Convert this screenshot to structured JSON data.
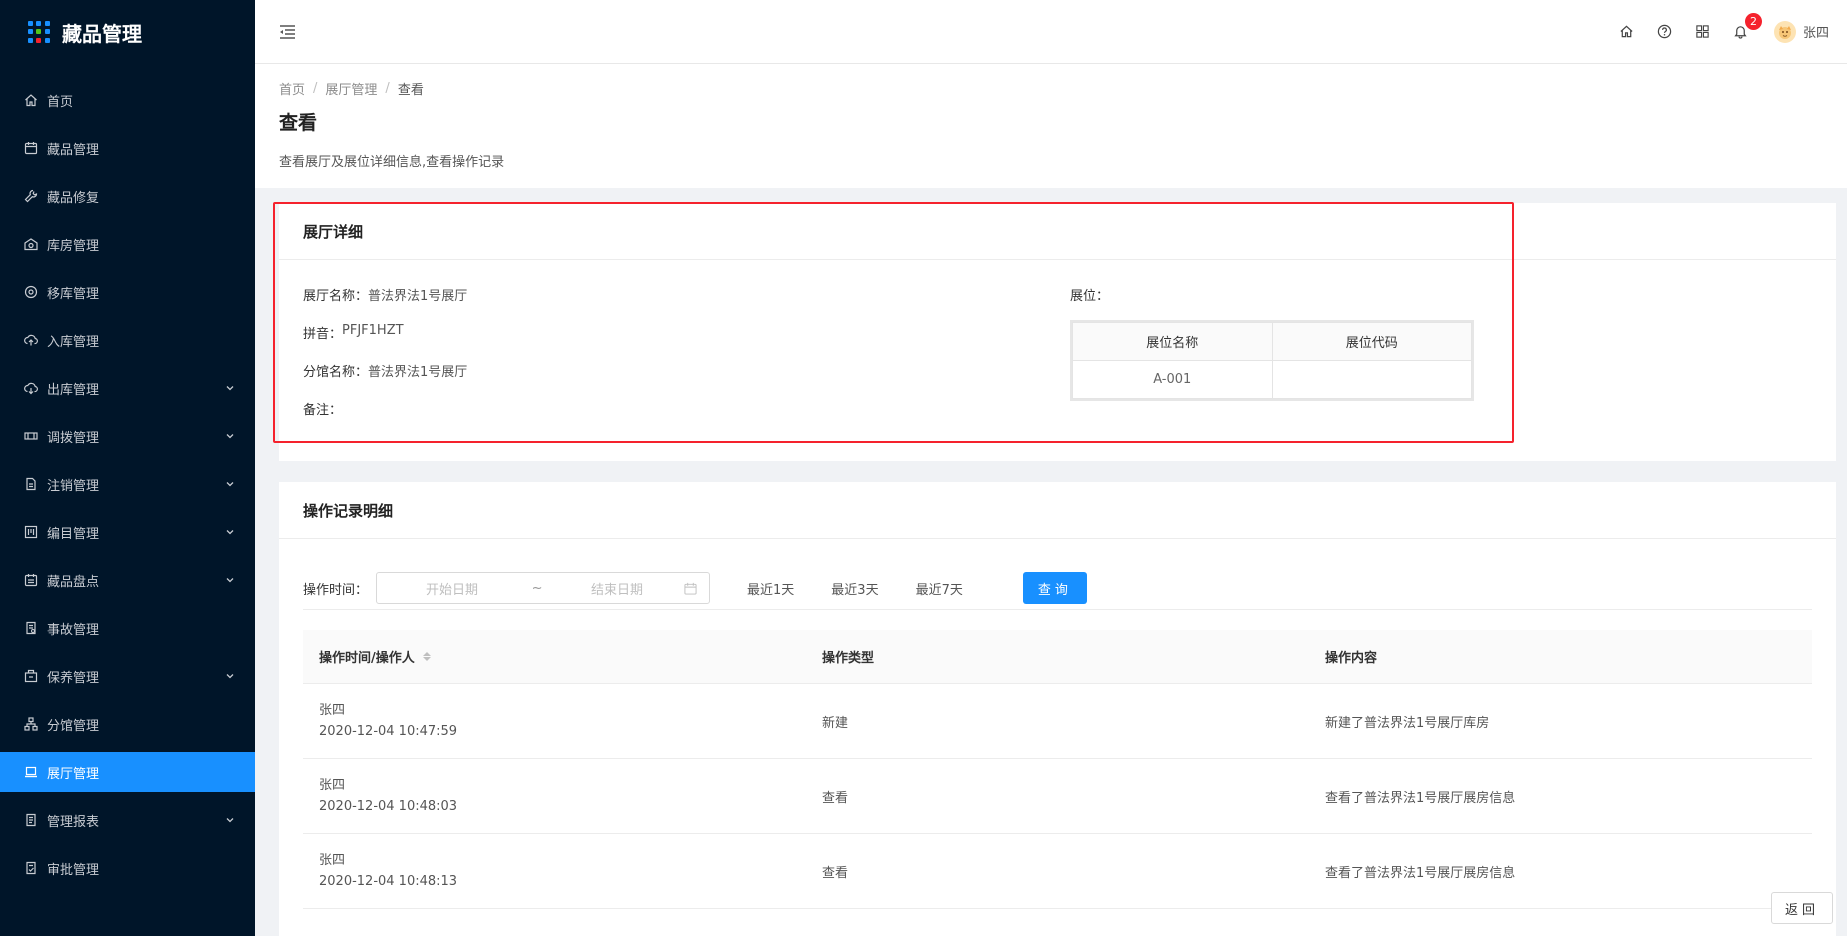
{
  "brand": {
    "title": "藏品管理"
  },
  "sidebar": {
    "items": [
      {
        "label": "首页",
        "icon": "home-icon",
        "has_arrow": false,
        "active": false
      },
      {
        "label": "藏品管理",
        "icon": "calendar-icon",
        "has_arrow": false,
        "active": false
      },
      {
        "label": "藏品修复",
        "icon": "wrench-icon",
        "has_arrow": false,
        "active": false
      },
      {
        "label": "库房管理",
        "icon": "warehouse-icon",
        "has_arrow": false,
        "active": false
      },
      {
        "label": "移库管理",
        "icon": "transfer-icon",
        "has_arrow": false,
        "active": false
      },
      {
        "label": "入库管理",
        "icon": "upload-icon",
        "has_arrow": false,
        "active": false
      },
      {
        "label": "出库管理",
        "icon": "cloud-icon",
        "has_arrow": true,
        "active": false
      },
      {
        "label": "调拨管理",
        "icon": "exchange-icon",
        "has_arrow": true,
        "active": false
      },
      {
        "label": "注销管理",
        "icon": "file-icon",
        "has_arrow": true,
        "active": false
      },
      {
        "label": "编目管理",
        "icon": "catalog-icon",
        "has_arrow": true,
        "active": false
      },
      {
        "label": "藏品盘点",
        "icon": "inventory-icon",
        "has_arrow": true,
        "active": false
      },
      {
        "label": "事故管理",
        "icon": "incident-icon",
        "has_arrow": false,
        "active": false
      },
      {
        "label": "保养管理",
        "icon": "maintenance-icon",
        "has_arrow": true,
        "active": false
      },
      {
        "label": "分馆管理",
        "icon": "branch-icon",
        "has_arrow": false,
        "active": false
      },
      {
        "label": "展厅管理",
        "icon": "laptop-icon",
        "has_arrow": false,
        "active": true
      },
      {
        "label": "管理报表",
        "icon": "report-icon",
        "has_arrow": true,
        "active": false
      },
      {
        "label": "审批管理",
        "icon": "approval-icon",
        "has_arrow": false,
        "active": false
      }
    ]
  },
  "header": {
    "notification_count": "2",
    "user_name": "张四"
  },
  "page": {
    "breadcrumb": [
      "首页",
      "展厅管理",
      "查看"
    ],
    "title": "查看",
    "description": "查看展厅及展位详细信息,查看操作记录"
  },
  "hall_detail": {
    "title": "展厅详细",
    "fields": [
      {
        "key": "展厅名称：",
        "value": "普法界法1号展厅"
      },
      {
        "key": "拼音：",
        "value": "PFJF1HZT"
      },
      {
        "key": "分馆名称：",
        "value": "普法界法1号展厅"
      },
      {
        "key": "备注：",
        "value": ""
      }
    ],
    "position_label": "展位：",
    "position_table": {
      "headers": [
        "展位名称",
        "展位代码"
      ],
      "rows": [
        [
          "A-001",
          ""
        ]
      ]
    }
  },
  "operation_log": {
    "title": "操作记录明细",
    "filter_label": "操作时间：",
    "start_placeholder": "开始日期",
    "range_sep": "~",
    "end_placeholder": "结束日期",
    "quick_ranges": [
      "最近1天",
      "最近3天",
      "最近7天"
    ],
    "query_button": "查询",
    "columns": [
      "操作时间/操作人",
      "操作类型",
      "操作内容"
    ],
    "rows": [
      {
        "user": "张四",
        "time": "2020-12-04 10:47:59",
        "type": "新建",
        "content": "新建了普法界法1号展厅库房"
      },
      {
        "user": "张四",
        "time": "2020-12-04 10:48:03",
        "type": "查看",
        "content": "查看了普法界法1号展厅展房信息"
      },
      {
        "user": "张四",
        "time": "2020-12-04 10:48:13",
        "type": "查看",
        "content": "查看了普法界法1号展厅展房信息"
      }
    ]
  },
  "footer": {
    "back_button": "返回"
  },
  "colors": {
    "sidebar_bg": "#001529",
    "primary": "#1890ff",
    "highlight": "#f5222d"
  }
}
